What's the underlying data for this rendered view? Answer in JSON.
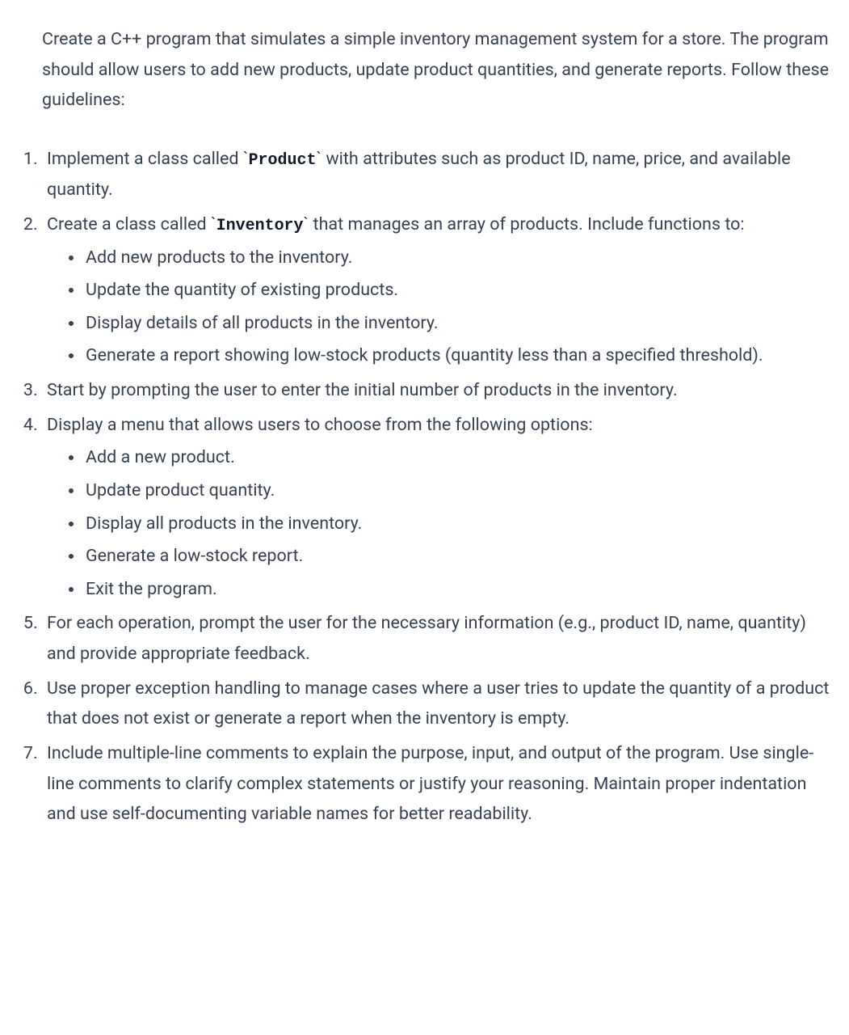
{
  "intro": "Create a C++ program that simulates a simple inventory management system for a store. The program should allow users to add new products, update product quantities, and generate reports. Follow these guidelines:",
  "items": [
    {
      "prefix": "Implement a class called ",
      "code": "Product",
      "suffix": " with attributes such as product ID, name, price, and available quantity."
    },
    {
      "prefix": "Create a class called ",
      "code": "Inventory",
      "suffix": " that manages an array of products. Include functions to:",
      "sub": [
        "Add new products to the inventory.",
        "Update the quantity of existing products.",
        "Display details of all products in the inventory.",
        "Generate a report showing low-stock products (quantity less than a specified threshold)."
      ]
    },
    {
      "text": "Start by prompting the user to enter the initial number of products in the inventory."
    },
    {
      "text": "Display a menu that allows users to choose from the following options:",
      "sub": [
        "Add a new product.",
        "Update product quantity.",
        "Display all products in the inventory.",
        "Generate a low-stock report.",
        "Exit the program."
      ]
    },
    {
      "text": "For each operation, prompt the user for the necessary information (e.g., product ID, name, quantity) and provide appropriate feedback."
    },
    {
      "text": "Use proper exception handling to manage cases where a user tries to update the quantity of a product that does not exist or generate a report when the inventory is empty."
    },
    {
      "text": "Include multiple-line comments to explain the purpose, input, and output of the program. Use single-line comments to clarify complex statements or justify your reasoning. Maintain proper indentation and use self-documenting variable names for better readability."
    }
  ]
}
